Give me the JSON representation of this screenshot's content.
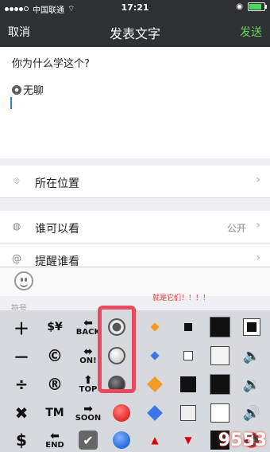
{
  "status_bar": {
    "carrier": "中国联通",
    "time": "17:21",
    "wifi_icon": "wifi-icon",
    "signal_dots": 5
  },
  "nav": {
    "cancel": "取消",
    "title": "发表文字",
    "send": "发送",
    "send_color": "#6bd35a"
  },
  "compose": {
    "line1": "你为什么学这个?",
    "line2": "无聊"
  },
  "rows": {
    "location": {
      "label": "所在位置"
    },
    "visibility": {
      "label": "谁可以看",
      "value": "公开"
    },
    "remind": {
      "label": "提醒谁看"
    }
  },
  "annotation": "就是它们！！！！",
  "keyboard": {
    "category_label": "符号",
    "keys": {
      "plus": "＋",
      "minus": "－",
      "divide": "÷",
      "times": "✖",
      "dollar": "$",
      "copyright": "©",
      "registered": "®",
      "tm": "TM",
      "back": "BACK",
      "on": "ON!",
      "top": "TOP",
      "soon": "SOON",
      "end": "END"
    }
  },
  "watermark": "9553",
  "colors": {
    "nav_bg": "#2e3133",
    "highlight": "#e84a5f",
    "accent": "#6bd35a"
  }
}
